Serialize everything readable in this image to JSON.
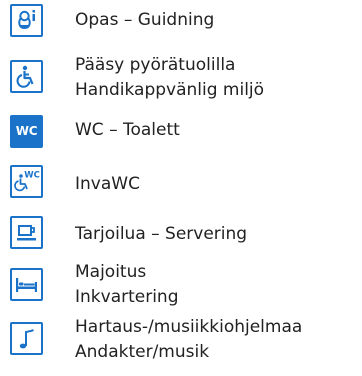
{
  "colors": {
    "icon_blue": "#1a73c9",
    "text": "#222222",
    "background": "#ffffff"
  },
  "items": [
    {
      "icon": "guide-info-icon",
      "lines": [
        "Opas – Guidning"
      ]
    },
    {
      "icon": "wheelchair-icon",
      "lines": [
        "Pääsy pyörätuolilla",
        "Handikappvänlig miljö"
      ]
    },
    {
      "icon": "wc-icon",
      "icon_text": "WC",
      "lines": [
        "WC – Toalett"
      ]
    },
    {
      "icon": "accessible-wc-icon",
      "icon_text": "WC",
      "lines": [
        "InvaWC"
      ]
    },
    {
      "icon": "coffee-cup-icon",
      "lines": [
        "Tarjoilua – Servering"
      ]
    },
    {
      "icon": "bed-icon",
      "lines": [
        "Majoitus",
        "Inkvartering"
      ]
    },
    {
      "icon": "music-note-icon",
      "lines": [
        "Hartaus-/musiikkiohjelmaa",
        "Andakter/musik"
      ]
    }
  ]
}
